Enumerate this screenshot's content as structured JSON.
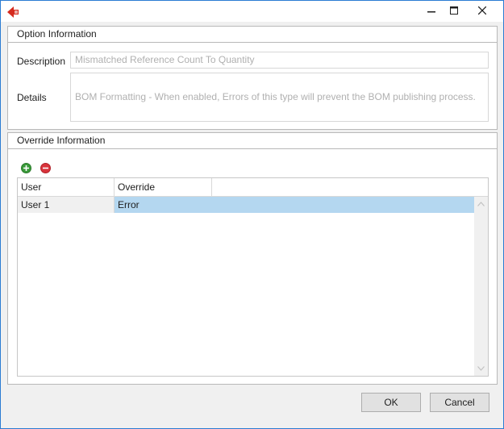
{
  "window": {
    "title": "",
    "icon": "red-back-arrow-icon",
    "controls": [
      "minimize",
      "maximize",
      "close"
    ]
  },
  "option_info": {
    "header": "Option Information",
    "description_label": "Description",
    "description_value": "Mismatched Reference Count To Quantity",
    "details_label": "Details",
    "details_value": "BOM Formatting - When enabled, Errors of this type will prevent the BOM publishing process."
  },
  "override_info": {
    "header": "Override Information",
    "add_icon": "add-circle-icon",
    "remove_icon": "remove-circle-icon",
    "columns": [
      "User",
      "Override",
      ""
    ],
    "rows": [
      {
        "user": "User 1",
        "override": "Error"
      }
    ]
  },
  "buttons": {
    "ok": "OK",
    "cancel": "Cancel"
  },
  "colors": {
    "window_border": "#2b7cd3",
    "selection": "#b4d7f0",
    "close_hover": "#e81123"
  }
}
